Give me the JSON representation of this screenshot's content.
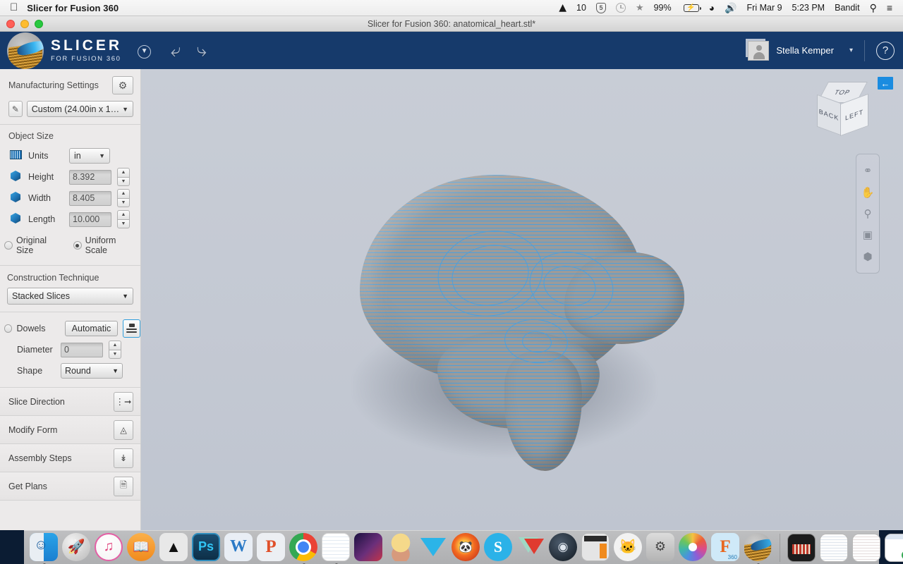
{
  "menubar": {
    "apple_icon": "apple-icon",
    "app_name": "Slicer for Fusion 360",
    "status_items": [
      {
        "icon": "autodesk-a-icon",
        "label": "10"
      },
      {
        "icon": "shield-icon",
        "label": "5"
      },
      {
        "icon": "clock-icon",
        "label": ""
      },
      {
        "icon": "bluetooth-icon",
        "label": "⁂"
      },
      {
        "icon": "battery-icon",
        "label": "99%"
      },
      {
        "icon": "wifi-icon",
        "label": ""
      },
      {
        "icon": "volume-icon",
        "label": ""
      }
    ],
    "date": "Fri Mar 9",
    "time": "5:23 PM",
    "user": "Bandit",
    "search_icon": "spotlight-search-icon",
    "notifications_icon": "notification-center-icon"
  },
  "window": {
    "title": "Slicer for Fusion 360: anatomical_heart.stl*"
  },
  "appheader": {
    "logo_line1": "SLICER",
    "logo_line2": "FOR FUSION 360",
    "dropdown_icon": "chevron-down-circle-icon",
    "undo_icon": "undo-arrow-icon",
    "redo_icon": "redo-arrow-icon",
    "user_name": "Stella Kemper",
    "user_caret": "▾",
    "help_label": "?",
    "bg_color": "#163a6b"
  },
  "panel": {
    "manufacturing": {
      "title": "Manufacturing Settings",
      "gear_icon": "gear-icon",
      "edit_icon": "pencil-icon",
      "material_value": "Custom (24.00in x 1…",
      "caret": "▼"
    },
    "object_size": {
      "title": "Object Size",
      "units_label": "Units",
      "units_value": "in",
      "units_caret": "▼",
      "fields": [
        {
          "label": "Height",
          "value": "8.392",
          "icon": "cube-height-icon"
        },
        {
          "label": "Width",
          "value": "8.405",
          "icon": "cube-width-icon"
        },
        {
          "label": "Length",
          "value": "10.000",
          "icon": "cube-length-icon"
        }
      ],
      "scale_options": [
        {
          "label": "Original Size",
          "selected": false
        },
        {
          "label": "Uniform Scale",
          "selected": true
        }
      ]
    },
    "construction": {
      "title": "Construction Technique",
      "value": "Stacked Slices",
      "caret": "▼"
    },
    "dowels": {
      "label": "Dowels",
      "auto_label": "Automatic",
      "toggle_icon": "dowel-stack-icon",
      "diameter_label": "Diameter",
      "diameter_value": "0",
      "shape_label": "Shape",
      "shape_value": "Round",
      "shape_caret": "▼"
    },
    "nav_items": [
      {
        "label": "Slice Direction",
        "icon": "slice-direction-icon"
      },
      {
        "label": "Modify Form",
        "icon": "modify-form-icon"
      },
      {
        "label": "Assembly Steps",
        "icon": "assembly-steps-icon"
      },
      {
        "label": "Get Plans",
        "icon": "get-plans-icon"
      }
    ]
  },
  "viewport": {
    "model_name": "anatomical_heart.stl",
    "background_color": "#c6ccd6",
    "slice_color": "#4aa0de",
    "surface_color": "#9b9b9b",
    "viewcube": {
      "top": "TOP",
      "left": "LEFT",
      "back": "BACK"
    },
    "back_button_icon": "arrow-left-icon",
    "tools": [
      {
        "icon": "orbit-icon"
      },
      {
        "icon": "pan-hand-icon"
      },
      {
        "icon": "zoom-magnifier-icon"
      },
      {
        "icon": "fit-to-window-icon"
      },
      {
        "icon": "view-cube-icon"
      }
    ]
  },
  "dock": {
    "apps": [
      {
        "name": "finder-icon",
        "class": "finder",
        "running": true
      },
      {
        "name": "launchpad-icon",
        "class": "launchpad",
        "running": false,
        "glyph": "🚀"
      },
      {
        "name": "itunes-icon",
        "class": "itunes",
        "running": false,
        "glyph": "♫"
      },
      {
        "name": "ibooks-icon",
        "class": "ibooks",
        "running": false,
        "glyph": "▤"
      },
      {
        "name": "inkscape-icon",
        "class": "inkscape",
        "running": false,
        "glyph": "▲"
      },
      {
        "name": "photoshop-icon",
        "class": "psd",
        "running": false,
        "glyph": "Ps"
      },
      {
        "name": "word-icon",
        "class": "word",
        "running": false,
        "glyph": "W"
      },
      {
        "name": "powerpoint-icon",
        "class": "ppt",
        "running": false,
        "glyph": "P"
      },
      {
        "name": "chrome-icon",
        "class": "chrome",
        "running": true
      },
      {
        "name": "textedit-icon",
        "class": "notes",
        "running": true
      },
      {
        "name": "anime-app-icon",
        "class": "anime",
        "running": false
      },
      {
        "name": "game-sprite-icon",
        "class": "sprite",
        "running": false
      },
      {
        "name": "vectorworks-icon",
        "class": "vtri",
        "running": false
      },
      {
        "name": "firefox-icon",
        "class": "firefox",
        "running": false,
        "glyph": "🦊"
      },
      {
        "name": "skype-icon",
        "class": "skype",
        "running": false,
        "glyph": "S"
      },
      {
        "name": "meshmixer-icon",
        "class": "tri2",
        "running": false
      },
      {
        "name": "steam-icon",
        "class": "steam",
        "running": false,
        "glyph": "◎"
      },
      {
        "name": "calculator-icon",
        "class": "calc",
        "running": false
      },
      {
        "name": "scratch-icon",
        "class": "scratch",
        "running": false,
        "glyph": "🐱"
      },
      {
        "name": "disk-utility-icon",
        "class": "diskutil",
        "running": false,
        "glyph": "⚕"
      },
      {
        "name": "photos-icon",
        "class": "photos",
        "running": false
      },
      {
        "name": "fusion360-icon",
        "class": "fusion",
        "running": false,
        "glyph": "F",
        "badge": "360"
      },
      {
        "name": "slicer-icon",
        "class": "slicerdock",
        "running": true
      }
    ],
    "minimized": [
      {
        "name": "minimized-keynote-window",
        "class": "w-kn"
      },
      {
        "name": "minimized-document-window",
        "class": "w-doc"
      },
      {
        "name": "minimized-document-window-2",
        "class": "w-doc2"
      },
      {
        "name": "minimized-browser-window",
        "class": "w-web"
      }
    ],
    "trash_icon": "trash-icon"
  }
}
